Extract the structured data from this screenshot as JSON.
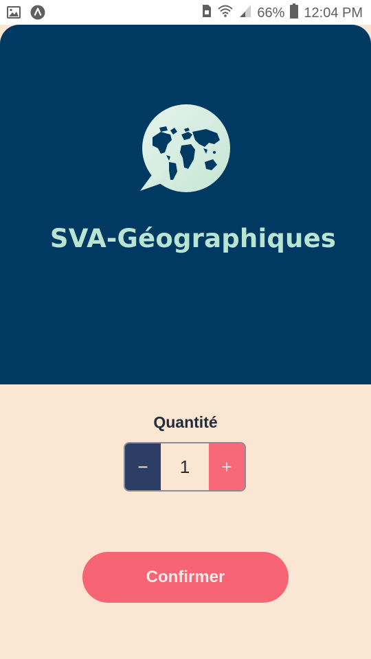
{
  "status_bar": {
    "battery": "66%",
    "time": "12:04 PM",
    "icons": [
      "image-icon",
      "app-icon",
      "sim-icon",
      "wifi-icon",
      "signal-icon",
      "battery-icon"
    ]
  },
  "hero": {
    "brand": "SVA-Géographiques",
    "logo_icon": "world-map-chat-icon",
    "background": "#003a63",
    "brand_color": "#b9e4d1"
  },
  "quantity": {
    "label": "Quantité",
    "value": "1",
    "minus_label": "−",
    "plus_label": "+"
  },
  "confirm": {
    "label": "Confirmer"
  },
  "colors": {
    "page_background": "#fae6d2",
    "minus_button": "#2d3e66",
    "plus_button": "#f76878",
    "confirm_button": "#f76474"
  }
}
